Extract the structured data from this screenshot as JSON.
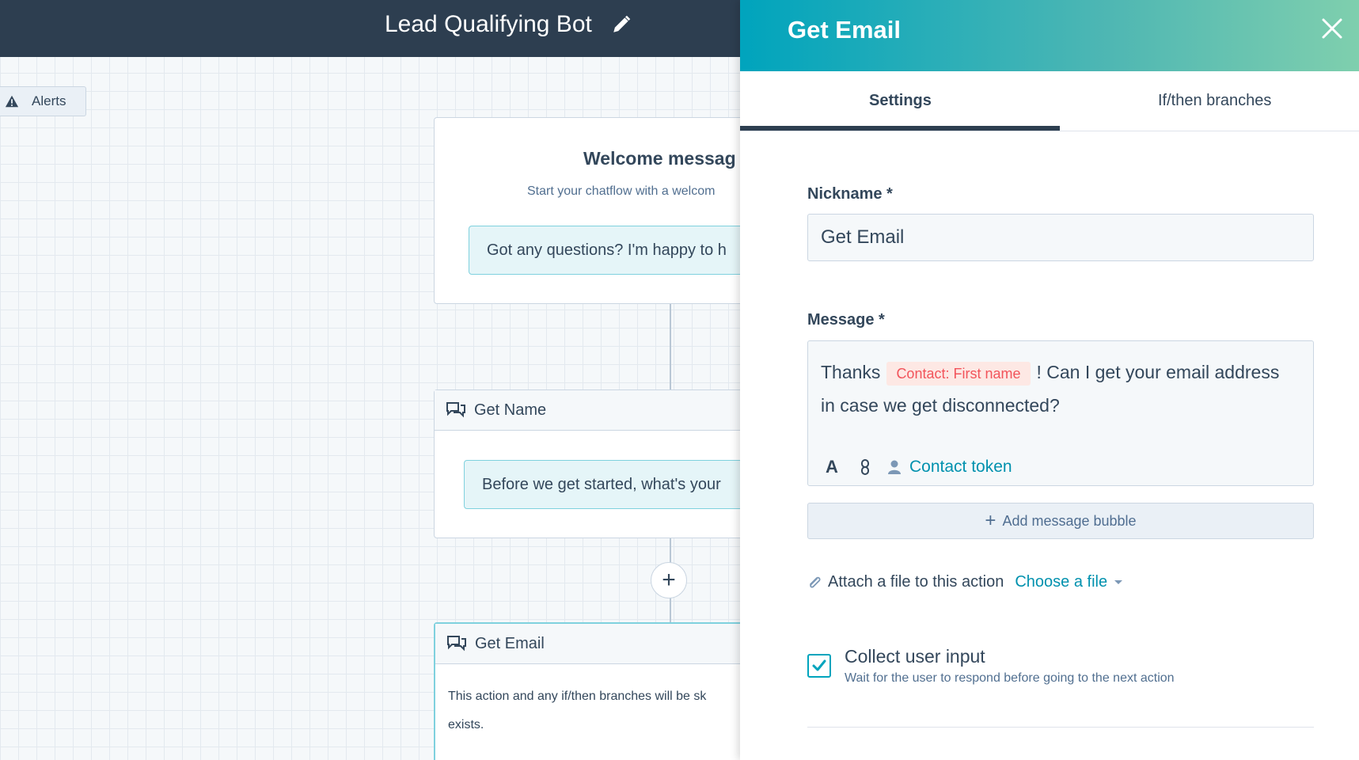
{
  "header": {
    "bot_title": "Lead Qualifying Bot"
  },
  "canvas": {
    "alerts_label": "Alerts",
    "nodes": {
      "welcome": {
        "title": "Welcome messag",
        "subtitle": "Start your chatflow with a welcom",
        "bubble": "Got any questions? I'm happy to h"
      },
      "get_name": {
        "title": "Get Name",
        "bubble": "Before we get started, what's your"
      },
      "get_email": {
        "title": "Get Email",
        "body_line1": "This action and any if/then branches will be sk",
        "body_line2": "exists."
      }
    },
    "add_action_symbol": "+"
  },
  "panel": {
    "title": "Get Email",
    "tabs": [
      {
        "label": "Settings",
        "active": true
      },
      {
        "label": "If/then branches",
        "active": false
      }
    ],
    "nickname": {
      "label": "Nickname *",
      "value": "Get Email"
    },
    "message": {
      "label": "Message *",
      "text_before": "Thanks",
      "token": "Contact: First name",
      "text_after": "! Can I get your email address in case we get disconnected?",
      "format_symbol": "A",
      "contact_token_label": "Contact token"
    },
    "add_message_bubble": "Add message bubble",
    "attach": {
      "label": "Attach a file to this action",
      "choose_label": "Choose a file"
    },
    "collect_input": {
      "checked": true,
      "label": "Collect user input",
      "hint": "Wait for the user to respond before going to the next action"
    }
  },
  "colors": {
    "topbar": "#2d3e50",
    "accent_teal": "#00a4bd",
    "link": "#0091ae",
    "token_text": "#f2545b",
    "token_bg": "#fde8e4"
  },
  "icons": [
    "pencil-icon",
    "warning-icon",
    "chat-icon",
    "close-icon",
    "link-icon",
    "person-icon",
    "paperclip-icon",
    "caret-down-icon",
    "checkmark-icon",
    "plus-icon"
  ]
}
